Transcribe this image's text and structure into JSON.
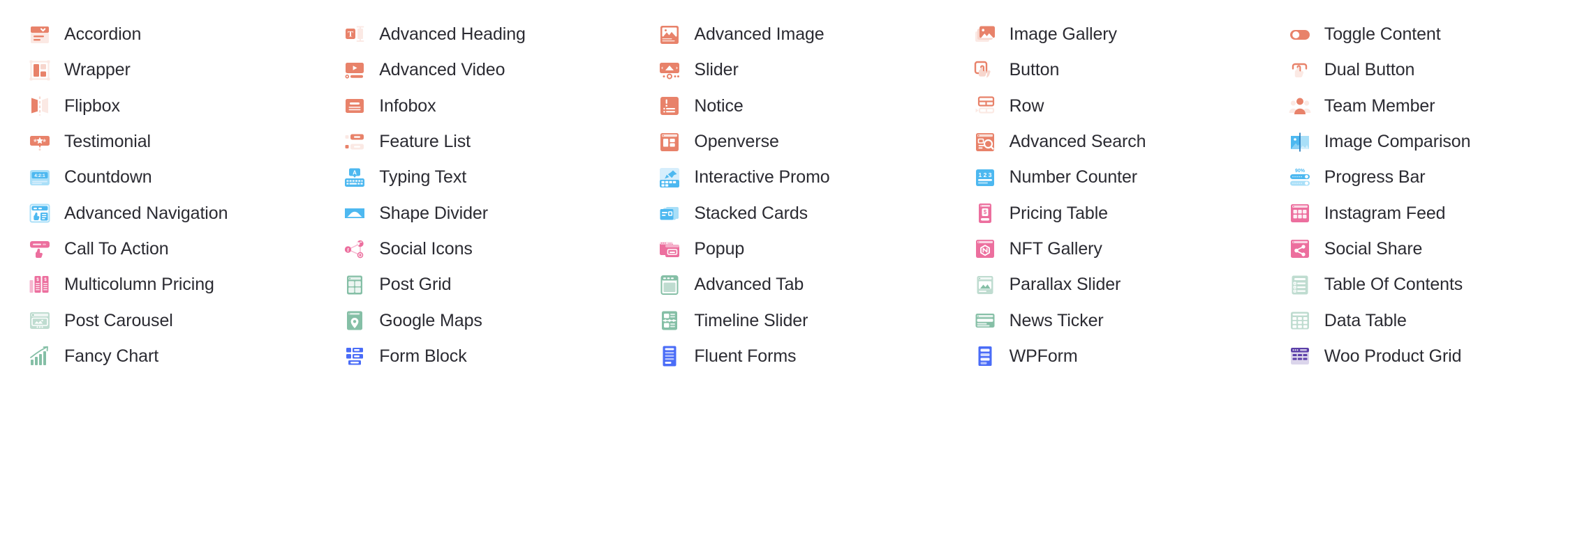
{
  "palette": {
    "orange": "#e8826a",
    "orange_light": "#f7d6cd",
    "orange_pale": "#fbe9e4",
    "blue": "#4db8f0",
    "blue_light": "#a9dff8",
    "blue_pale": "#d6eefc",
    "pink": "#ec6f9e",
    "pink_light": "#f6b7d0",
    "pink_pale": "#fbdbe8",
    "green": "#85bfa6",
    "green_light": "#bfdcd0",
    "green_pale": "#dcece5",
    "royal": "#4a6cf7",
    "royal_light": "#a7b7fb",
    "purple": "#5b3fa8",
    "purple_light": "#bdb2da",
    "text": "#2b2b32",
    "background": "#ffffff"
  },
  "grid": {
    "columns": 5,
    "rows": 11
  },
  "columns": [
    {
      "index": 0,
      "items": [
        {
          "label": "Accordion",
          "icon": "accordion-icon",
          "color": "orange"
        },
        {
          "label": "Wrapper",
          "icon": "wrapper-icon",
          "color": "orange"
        },
        {
          "label": "Flipbox",
          "icon": "flipbox-icon",
          "color": "orange"
        },
        {
          "label": "Testimonial",
          "icon": "testimonial-icon",
          "color": "orange"
        },
        {
          "label": "Countdown",
          "icon": "countdown-icon",
          "color": "blue"
        },
        {
          "label": "Advanced Navigation",
          "icon": "advanced-navigation-icon",
          "color": "blue"
        },
        {
          "label": "Call To Action",
          "icon": "call-to-action-icon",
          "color": "pink"
        },
        {
          "label": "Multicolumn Pricing",
          "icon": "multicolumn-pricing-icon",
          "color": "pink"
        },
        {
          "label": "Post Carousel",
          "icon": "post-carousel-icon",
          "color": "green"
        },
        {
          "label": "Fancy Chart",
          "icon": "fancy-chart-icon",
          "color": "green"
        }
      ]
    },
    {
      "index": 1,
      "items": [
        {
          "label": "Advanced Heading",
          "icon": "advanced-heading-icon",
          "color": "orange"
        },
        {
          "label": "Advanced Video",
          "icon": "advanced-video-icon",
          "color": "orange"
        },
        {
          "label": "Infobox",
          "icon": "infobox-icon",
          "color": "orange"
        },
        {
          "label": "Feature List",
          "icon": "feature-list-icon",
          "color": "orange"
        },
        {
          "label": "Typing Text",
          "icon": "typing-text-icon",
          "color": "blue"
        },
        {
          "label": "Shape Divider",
          "icon": "shape-divider-icon",
          "color": "blue"
        },
        {
          "label": "Social Icons",
          "icon": "social-icons-icon",
          "color": "pink"
        },
        {
          "label": "Post Grid",
          "icon": "post-grid-icon",
          "color": "green"
        },
        {
          "label": "Google Maps",
          "icon": "google-maps-icon",
          "color": "green"
        },
        {
          "label": "Form Block",
          "icon": "form-block-icon",
          "color": "royal"
        }
      ]
    },
    {
      "index": 2,
      "items": [
        {
          "label": "Advanced Image",
          "icon": "advanced-image-icon",
          "color": "orange"
        },
        {
          "label": "Slider",
          "icon": "slider-icon",
          "color": "orange"
        },
        {
          "label": "Notice",
          "icon": "notice-icon",
          "color": "orange"
        },
        {
          "label": "Openverse",
          "icon": "openverse-icon",
          "color": "orange"
        },
        {
          "label": "Interactive Promo",
          "icon": "interactive-promo-icon",
          "color": "blue"
        },
        {
          "label": "Stacked Cards",
          "icon": "stacked-cards-icon",
          "color": "blue"
        },
        {
          "label": "Popup",
          "icon": "popup-icon",
          "color": "pink"
        },
        {
          "label": "Advanced Tab",
          "icon": "advanced-tab-icon",
          "color": "green"
        },
        {
          "label": "Timeline Slider",
          "icon": "timeline-slider-icon",
          "color": "green"
        },
        {
          "label": "Fluent Forms",
          "icon": "fluent-forms-icon",
          "color": "royal"
        }
      ]
    },
    {
      "index": 3,
      "items": [
        {
          "label": "Image Gallery",
          "icon": "image-gallery-icon",
          "color": "orange"
        },
        {
          "label": "Button",
          "icon": "button-icon",
          "color": "orange"
        },
        {
          "label": "Row",
          "icon": "row-icon",
          "color": "orange"
        },
        {
          "label": "Advanced Search",
          "icon": "advanced-search-icon",
          "color": "orange"
        },
        {
          "label": "Number Counter",
          "icon": "number-counter-icon",
          "color": "blue"
        },
        {
          "label": "Pricing Table",
          "icon": "pricing-table-icon",
          "color": "pink"
        },
        {
          "label": "NFT Gallery",
          "icon": "nft-gallery-icon",
          "color": "pink"
        },
        {
          "label": "Parallax Slider",
          "icon": "parallax-slider-icon",
          "color": "green"
        },
        {
          "label": "News Ticker",
          "icon": "news-ticker-icon",
          "color": "green"
        },
        {
          "label": "WPForm",
          "icon": "wpform-icon",
          "color": "royal"
        }
      ]
    },
    {
      "index": 4,
      "items": [
        {
          "label": "Toggle Content",
          "icon": "toggle-content-icon",
          "color": "orange"
        },
        {
          "label": "Dual Button",
          "icon": "dual-button-icon",
          "color": "orange"
        },
        {
          "label": "Team Member",
          "icon": "team-member-icon",
          "color": "orange"
        },
        {
          "label": "Image Comparison",
          "icon": "image-comparison-icon",
          "color": "blue"
        },
        {
          "label": "Progress Bar",
          "icon": "progress-bar-icon",
          "color": "blue",
          "value": "90%"
        },
        {
          "label": "Instagram Feed",
          "icon": "instagram-feed-icon",
          "color": "pink"
        },
        {
          "label": "Social Share",
          "icon": "social-share-icon",
          "color": "pink"
        },
        {
          "label": "Table Of Contents",
          "icon": "table-of-contents-icon",
          "color": "green"
        },
        {
          "label": "Data Table",
          "icon": "data-table-icon",
          "color": "green"
        },
        {
          "label": "Woo Product Grid",
          "icon": "woo-product-grid-icon",
          "color": "purple"
        }
      ]
    }
  ]
}
